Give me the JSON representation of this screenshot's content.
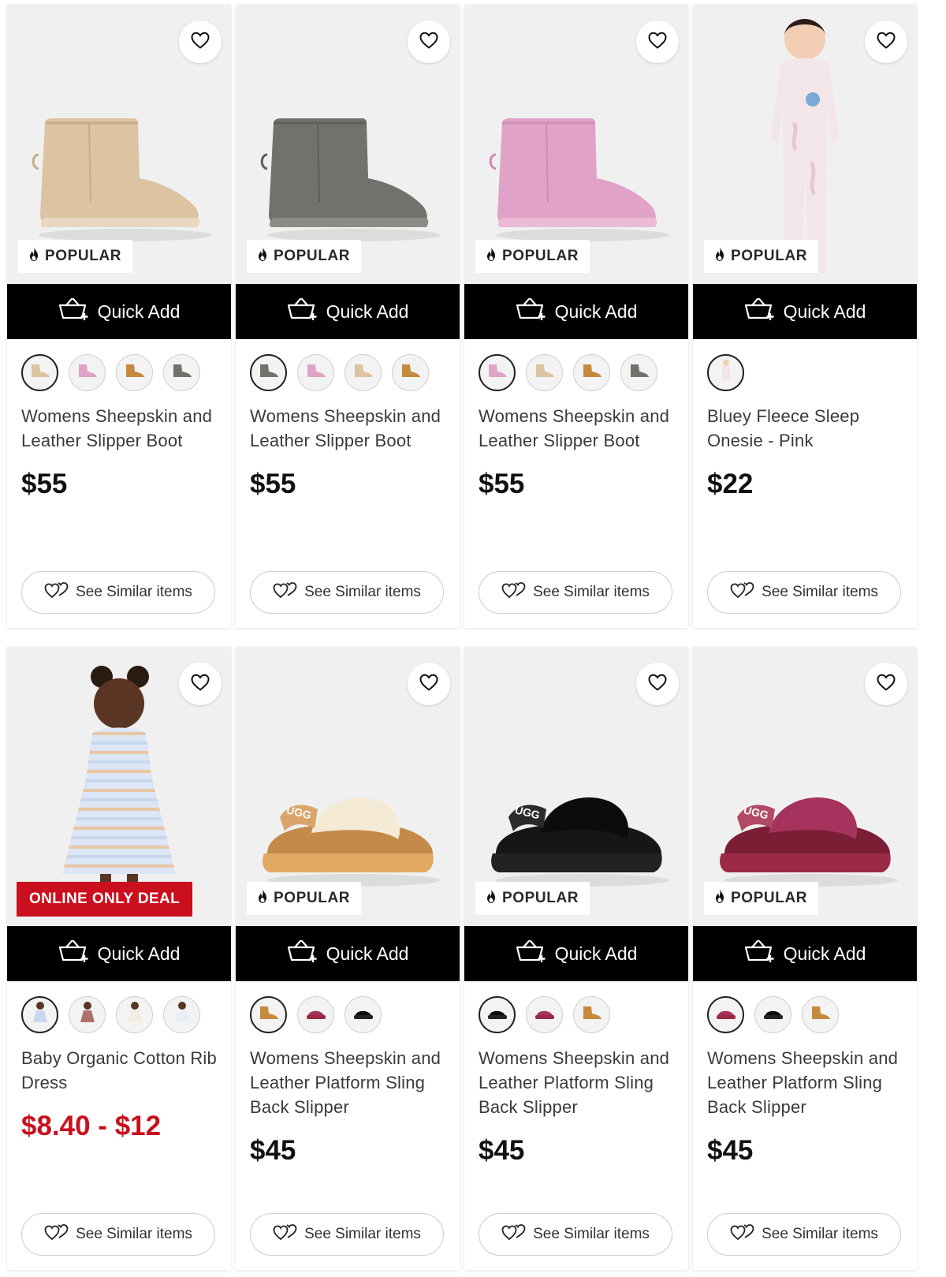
{
  "common": {
    "quick_add_label": "Quick Add",
    "see_similar_label": "See Similar items",
    "popular_label": "POPULAR",
    "deal_label": "ONLINE ONLY DEAL"
  },
  "colors": {
    "sale_price": "#cc0f1e",
    "quick_add_bg": "#000000"
  },
  "products": [
    {
      "title": "Womens Sheepskin and Leather Slipper Boot",
      "price": "$55",
      "badge": "POPULAR",
      "image": "sand-mini-boot",
      "swatches": [
        "sand",
        "pink",
        "chestnut",
        "grey"
      ],
      "selected_swatch": 0
    },
    {
      "title": "Womens Sheepskin and Leather Slipper Boot",
      "price": "$55",
      "badge": "POPULAR",
      "image": "grey-mini-boot",
      "swatches": [
        "grey",
        "pink",
        "sand",
        "chestnut"
      ],
      "selected_swatch": 0
    },
    {
      "title": "Womens Sheepskin and Leather Slipper Boot",
      "price": "$55",
      "badge": "POPULAR",
      "image": "pink-mini-boot",
      "swatches": [
        "pink",
        "sand",
        "chestnut",
        "grey"
      ],
      "selected_swatch": 0
    },
    {
      "title": "Bluey Fleece Sleep Onesie - Pink",
      "price": "$22",
      "badge": "POPULAR",
      "image": "kid-onesie",
      "swatches": [
        "onesie"
      ],
      "selected_swatch": 0
    },
    {
      "title": "Baby Organic Cotton Rib Dress",
      "price": "$8.40 - $12",
      "badge": "ONLINE ONLY DEAL",
      "image": "baby-dress",
      "swatches": [
        "stripe",
        "floral",
        "cream",
        "white"
      ],
      "selected_swatch": 0,
      "sale": true
    },
    {
      "title": "Womens Sheepskin and Leather Platform Sling Back Slipper",
      "price": "$45",
      "badge": "POPULAR",
      "image": "chestnut-platform",
      "swatches": [
        "chestnut",
        "burgundy",
        "black"
      ],
      "selected_swatch": 0
    },
    {
      "title": "Womens Sheepskin and Leather Platform Sling Back Slipper",
      "price": "$45",
      "badge": "POPULAR",
      "image": "black-platform",
      "swatches": [
        "black",
        "burgundy",
        "chestnut"
      ],
      "selected_swatch": 0
    },
    {
      "title": "Womens Sheepskin and Leather Platform Sling Back Slipper",
      "price": "$45",
      "badge": "POPULAR",
      "image": "burgundy-platform",
      "swatches": [
        "burgundy",
        "black",
        "chestnut"
      ],
      "selected_swatch": 0
    }
  ],
  "brand_strap_text": "UGG",
  "icons": {
    "wishlist": "heart-icon",
    "quick_add": "basket-plus-icon",
    "popular": "flame-icon",
    "similar": "hearts-outline-icon"
  }
}
